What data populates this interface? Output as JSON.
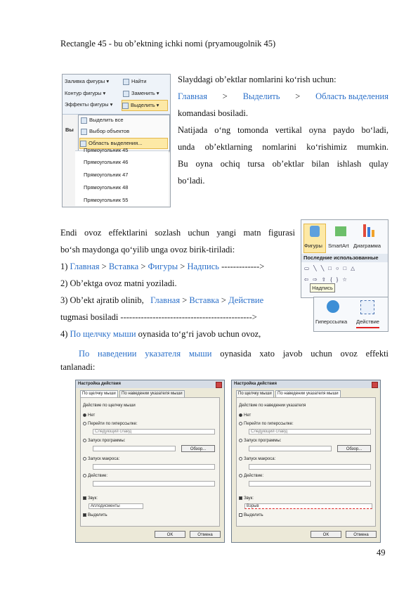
{
  "heading_line": "Rectangle 45 - bu ob’ektning ichki nomi (pryamougolnik 45)",
  "para1": {
    "line1": "Slayddagi ob’ektlar nomlarini ko‘rish uchun:",
    "path": [
      "Главная",
      ">",
      "Выделить",
      ">",
      "Область выделения"
    ],
    "line3": "komandasi bosiladi.",
    "line4": "Natijada o‘ng tomonda vertikal oyna paydo bo‘ladi,",
    "line5": "unda ob’ektlarning nomlarini ko‘rishimiz mumkin.",
    "line6": "Bu oyna ochiq tursa ob’ektlar bilan ishlash qulay",
    "line7": "bo‘ladi."
  },
  "menu_shot": {
    "ribbon_rows": [
      "Заливка фигуры ▾",
      "Контур фигуры ▾",
      "Эффекты фигуры ▾"
    ],
    "ribbon_right": [
      "Найти",
      "Заменить ▾",
      "Выделить ▾"
    ],
    "menu_items": [
      "Выделить все",
      "Выбор объектов",
      "Область выделения..."
    ],
    "list_header": "Вы",
    "list_items": [
      "Прямоугольник 45",
      "Прямоугольник 46",
      "Прямоугольник 47",
      "Прямоугольник 48",
      "Прямоугольник 55"
    ]
  },
  "para2": {
    "line1": "Endi ovoz effektlarini sozlash uchun yangi matn figurasi",
    "line2": "bo‘sh maydonga qo‘yilib unga ovoz birik-tiriladi:",
    "step1_num": "1)",
    "step1_path": [
      "Главная",
      ">",
      "Вставка",
      ">",
      "Фигуры",
      ">",
      "Надпись"
    ],
    "step1_arrow": "------------->",
    "step2": "2) Ob’ektga ovoz matni yoziladi.",
    "step3_text": "3) Ob’ekt ajratib olinib,",
    "step3_path": [
      "Главная",
      ">",
      "Вставка",
      ">",
      "Действие"
    ],
    "step3_line2": "tugmasi bosiladi --------------------------------------------->",
    "step4_num": "4)",
    "step4_link": "По щелчку мыши",
    "step4_text": "oynasida to‘g‘ri javob uchun ovoz,",
    "step5_link": "По наведении указателя мыши",
    "step5_text": "oynasida xato javob uchun ovoz effekti",
    "step5_line2": "tanlanadi:"
  },
  "insert_shot": {
    "figures_label": "Фигуры",
    "smartart_label": "SmartArt",
    "diagram_label": "Диаграмма",
    "recent_label": "Последние использованные",
    "tooltip": "Надпись",
    "hyperlink_label": "Гиперссылка",
    "action_label": "Действие"
  },
  "dialogs": [
    {
      "title": "Настройка действия",
      "tabs": [
        "По щелчку мыши",
        "По наведении указателя мыши"
      ],
      "group": "Действие по щелчку мыши",
      "options": [
        "Нет",
        "Перейти по гиперссылке:",
        "Запуск программы:",
        "Запуск макроса:",
        "Действие:"
      ],
      "hyperlink_value": "Следующий слайд",
      "browse": "Обзор...",
      "sound_label": "Звук:",
      "sound_value": "Аплодисменты",
      "highlight_label": "Выделить",
      "ok": "OK",
      "cancel": "Отмена"
    },
    {
      "title": "Настройка действия",
      "tabs": [
        "По щелчку мыши",
        "По наведении указателя мыши"
      ],
      "group": "Действие по наведении указателя",
      "options": [
        "Нет",
        "Перейти по гиперссылке:",
        "Запуск программы:",
        "Запуск макроса:",
        "Действие:"
      ],
      "hyperlink_value": "Следующий слайд",
      "browse": "Обзор...",
      "sound_label": "Звук:",
      "sound_value": "Взрыв",
      "highlight_label": "Выделить",
      "ok": "OK",
      "cancel": "Отмена"
    }
  ],
  "page_number": "49"
}
